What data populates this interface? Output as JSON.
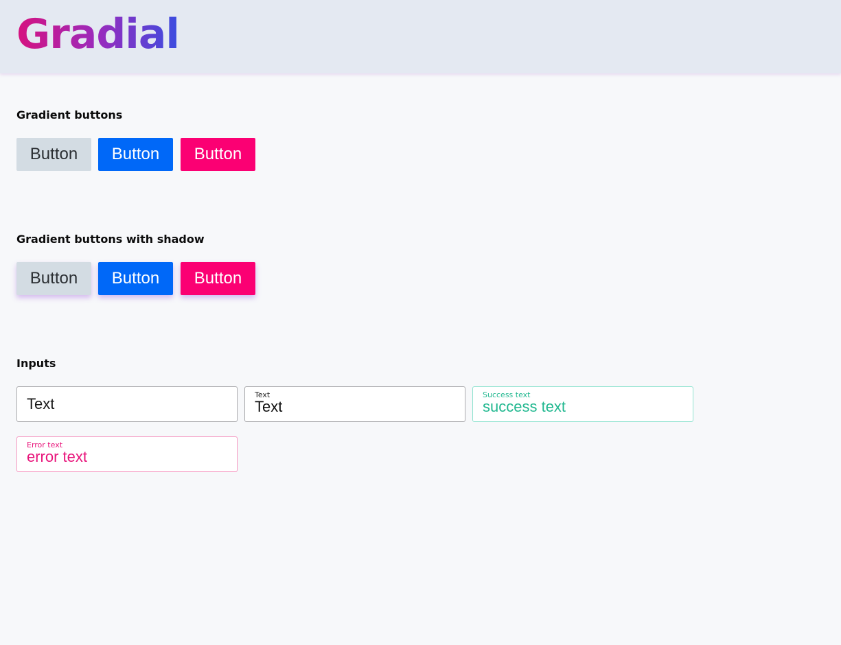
{
  "header": {
    "logo": "Gradial"
  },
  "sections": {
    "gradient_buttons": {
      "title": "Gradient buttons",
      "buttons": [
        "Button",
        "Button",
        "Button"
      ]
    },
    "gradient_buttons_shadow": {
      "title": "Gradient buttons with shadow",
      "buttons": [
        "Button",
        "Button",
        "Button"
      ]
    },
    "inputs": {
      "title": "Inputs",
      "plain": {
        "value": "Text"
      },
      "labeled": {
        "label": "Text",
        "value": "Text"
      },
      "success": {
        "label": "Success text",
        "value": "success text"
      },
      "error": {
        "label": "Error text",
        "value": "error text"
      }
    }
  },
  "colors": {
    "button_default": "#d3dce3",
    "button_primary": "#0068f8",
    "button_danger": "#fb0073",
    "success": "#22b890",
    "error": "#e8137a",
    "logo_gradient": [
      "#d6127f",
      "#9a2bbd",
      "#3a4de0"
    ]
  }
}
